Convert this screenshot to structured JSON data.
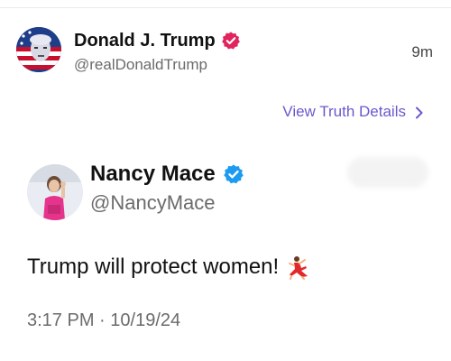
{
  "outer_post": {
    "author_name": "Donald J. Trump",
    "handle": "@realDonaldTrump",
    "time_ago": "9m",
    "verified_color": "#e0245e"
  },
  "actions": {
    "view_details": "View Truth Details"
  },
  "quoted_post": {
    "author_name": "Nancy Mace",
    "handle": "@NancyMace",
    "text": "Trump will protect women!",
    "emoji_icon": "woman-dancing-icon",
    "time": "3:17 PM",
    "date": "10/19/24",
    "verified_color": "#1d9bf0"
  },
  "colors": {
    "accent_link": "#6a5acd",
    "muted_text": "#6b6b6b"
  }
}
